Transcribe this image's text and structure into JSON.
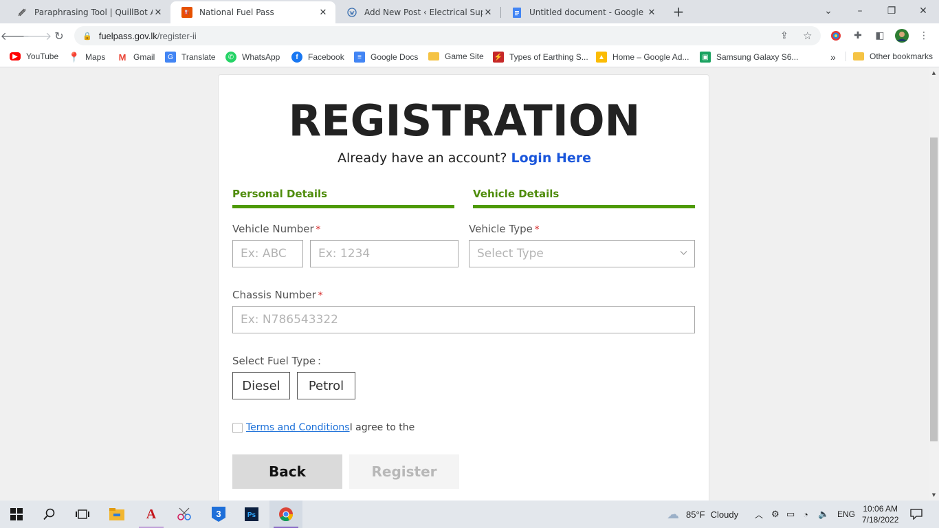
{
  "browser": {
    "tabs": [
      {
        "title": "Paraphrasing Tool | QuillBot AI",
        "icon": "quill-icon"
      },
      {
        "title": "National Fuel Pass",
        "icon": "fuelpass-icon"
      },
      {
        "title": "Add New Post ‹ Electrical Suppor",
        "icon": "wordpress-icon"
      },
      {
        "title": "Untitled document - Google Doc",
        "icon": "docs-icon"
      }
    ],
    "url_host": "fuelpass.gov.lk",
    "url_path": "/register-ii",
    "bookmarks": [
      {
        "label": "YouTube",
        "icon": "youtube-icon",
        "color": "#ff0000"
      },
      {
        "label": "Maps",
        "icon": "maps-icon",
        "color": "#34a853"
      },
      {
        "label": "Gmail",
        "icon": "gmail-icon",
        "color": "#ea4335"
      },
      {
        "label": "Translate",
        "icon": "translate-icon",
        "color": "#4285f4"
      },
      {
        "label": "WhatsApp",
        "icon": "whatsapp-icon",
        "color": "#25d366"
      },
      {
        "label": "Facebook",
        "icon": "facebook-icon",
        "color": "#1877f2"
      },
      {
        "label": "Google Docs",
        "icon": "docs-icon",
        "color": "#4285f4"
      },
      {
        "label": "Game Site",
        "icon": "folder-icon",
        "color": "#f5c344"
      },
      {
        "label": "Types of Earthing S...",
        "icon": "earthing-icon",
        "color": "#c62828"
      },
      {
        "label": "Home – Google Ad...",
        "icon": "ads-icon",
        "color": "#fbbc04"
      },
      {
        "label": "Samsung Galaxy S6...",
        "icon": "samsung-icon",
        "color": "#1aa260"
      }
    ],
    "more_bookmarks": "»",
    "other_bookmarks": "Other bookmarks"
  },
  "form": {
    "title": "REGISTRATION",
    "already_text": "Already have an account?",
    "login_link": "Login Here",
    "steps": [
      "Personal Details",
      "Vehicle Details"
    ],
    "vehicle_number_label": "Vehicle Number",
    "vehicle_number_prefix_placeholder": "Ex: ABC",
    "vehicle_number_digits_placeholder": "Ex: 1234",
    "vehicle_type_label": "Vehicle Type",
    "vehicle_type_placeholder": "Select Type",
    "chassis_label": "Chassis Number",
    "chassis_placeholder": "Ex: N786543322",
    "required_mark": "*",
    "fuel_type_label": "Select Fuel Type",
    "fuel_type_colon": ":",
    "fuel_options": [
      "Diesel",
      "Petrol"
    ],
    "terms_link": "Terms and Conditions",
    "terms_text": "I agree to the",
    "back_button": "Back",
    "register_button": "Register"
  },
  "taskbar": {
    "weather_temp": "85°F",
    "weather_desc": "Cloudy",
    "language": "ENG",
    "time": "10:06 AM",
    "date": "7/18/2022"
  },
  "colors": {
    "accent_green": "#4e9a06",
    "link_blue": "#1a56db",
    "required_red": "#d42020"
  }
}
